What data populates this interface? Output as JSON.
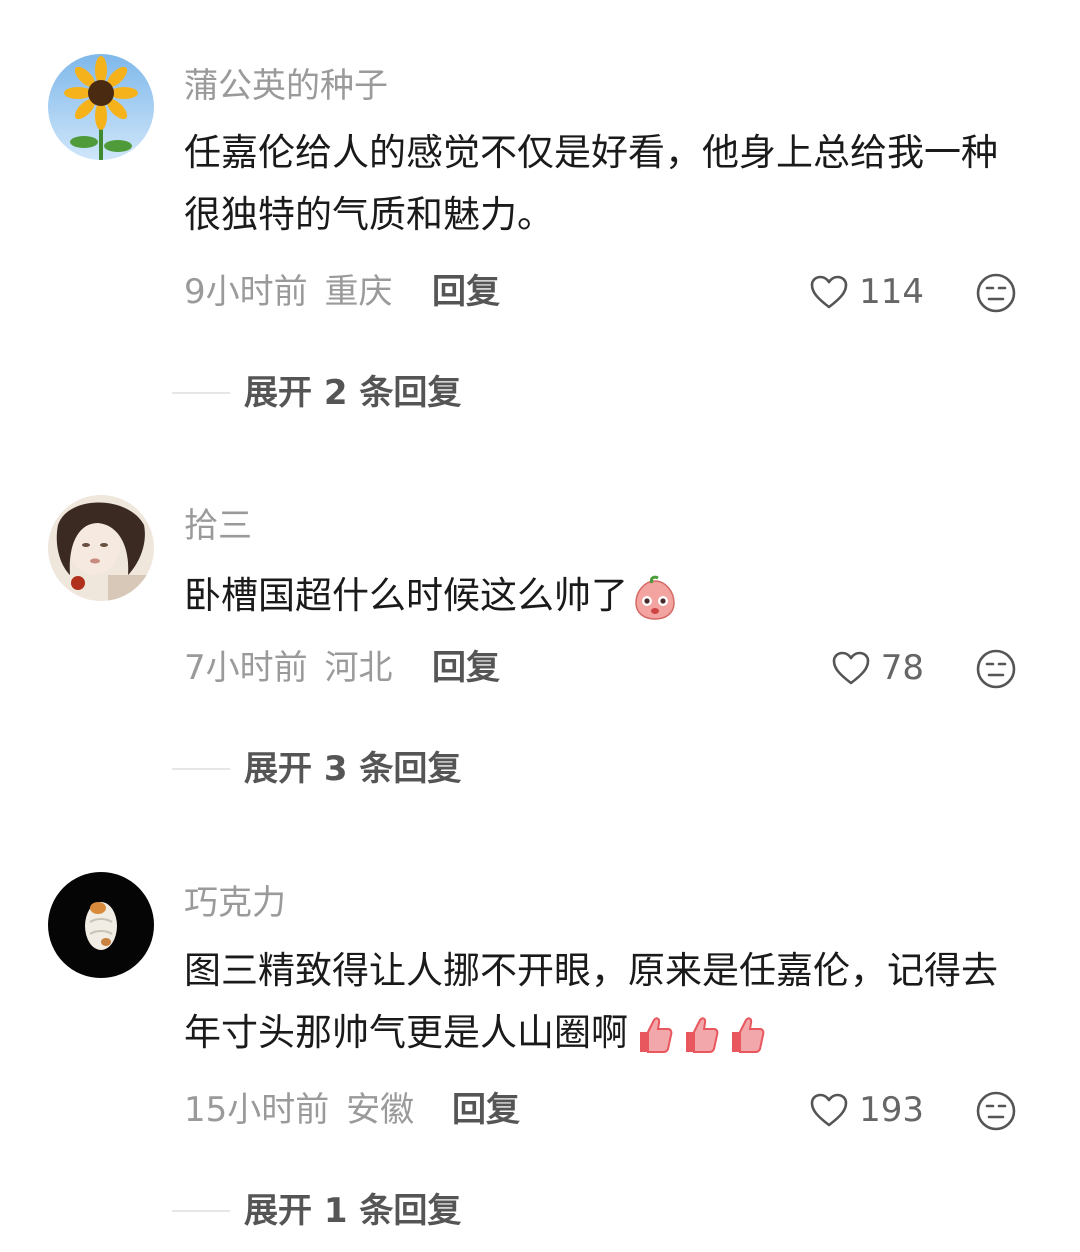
{
  "comments": [
    {
      "username": "蒲公英的种子",
      "text": "任嘉伦给人的感觉不仅是好看，他身上总给我一种很独特的气质和魅力。",
      "time": "9小时前",
      "location": "重庆",
      "reply_label": "回复",
      "likes": "114",
      "expand_label": "展开 2 条回复",
      "avatar_icon": "sunflower-avatar"
    },
    {
      "username": "拾三",
      "text": "卧槽国超什么时候这么帅了",
      "time": "7小时前",
      "location": "河北",
      "reply_label": "回复",
      "likes": "78",
      "expand_label": "展开 3 条回复",
      "avatar_icon": "girl-avatar"
    },
    {
      "username": "巧克力",
      "text": "图三精致得让人挪不开眼，原来是任嘉伦，记得去年寸头那帅气更是人山圈啊",
      "time": "15小时前",
      "location": "安徽",
      "reply_label": "回复",
      "likes": "193",
      "expand_label": "展开 1 条回复",
      "avatar_icon": "figure-dark-avatar"
    }
  ],
  "icons": {
    "like": "heart-outline-icon",
    "dislike": "neutral-face-icon",
    "emoji_1": "peach-shy-emoji",
    "emoji_2": "thumbs-up-emoji"
  },
  "colors": {
    "muted_text": "#9a9a9a",
    "main_text": "#1a1a1a",
    "emoji_red": "#e8575e"
  }
}
